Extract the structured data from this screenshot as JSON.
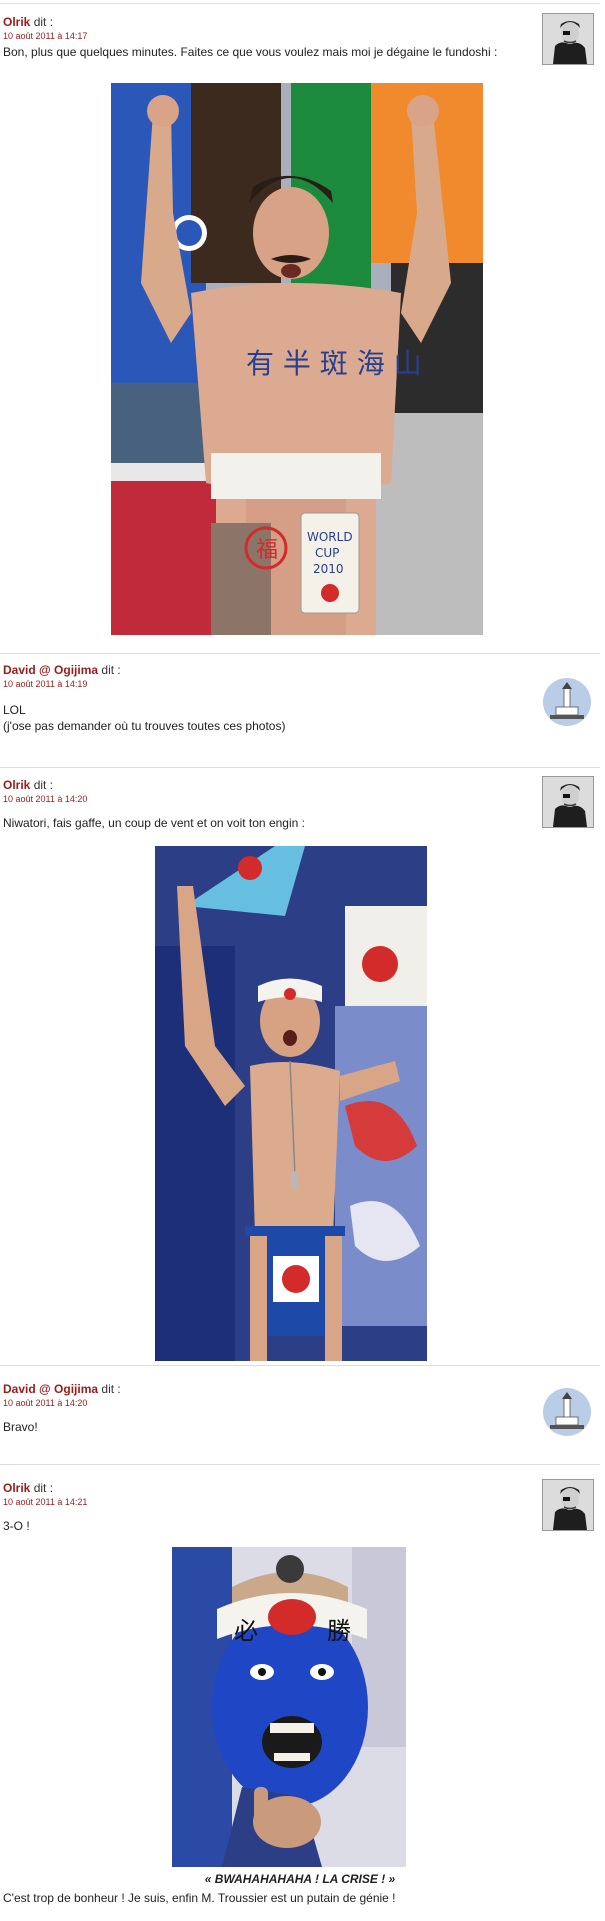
{
  "comments": [
    {
      "author": "Olrik",
      "says": "dit :",
      "date": "10 août 2011 à 14:17",
      "lines": [
        "Bon, plus que quelques minutes. Faites ce que vous voulez mais moi je dégaine le fundoshi :"
      ],
      "image_text": {
        "chest": "有 半 斑 海 山",
        "sign": [
          "WORLD",
          "CUP",
          "2010"
        ],
        "stamp": "福"
      }
    },
    {
      "author": "David @ Ogijima",
      "says": "dit :",
      "date": "10 août 2011 à 14:19",
      "lines": [
        "LOL",
        "(j'ose pas demander où tu trouves toutes ces photos)"
      ]
    },
    {
      "author": "Olrik",
      "says": "dit :",
      "date": "10 août 2011 à 14:20",
      "lines": [
        "Niwatori, fais gaffe, un coup de vent et on voit ton engin :"
      ]
    },
    {
      "author": "David @ Ogijima",
      "says": "dit :",
      "date": "10 août 2011 à 14:20",
      "lines": [
        "Bravo!"
      ]
    },
    {
      "author": "Olrik",
      "says": "dit :",
      "date": "10 août 2011 à 14:21",
      "lines": [
        "3-O !"
      ],
      "caption": "« BWAHAHAHAHA ! LA CRISE ! »",
      "after": "C'est trop de bonheur ! Je suis, enfin M. Troussier est un putain de génie !",
      "image_text": {
        "left": "必",
        "right": "勝"
      }
    }
  ],
  "colors": {
    "author": "#9b1b1b",
    "separator": "#dddddd",
    "text": "#222222",
    "japan_red": "#d32a2a",
    "blue": "#1f3f9c"
  }
}
